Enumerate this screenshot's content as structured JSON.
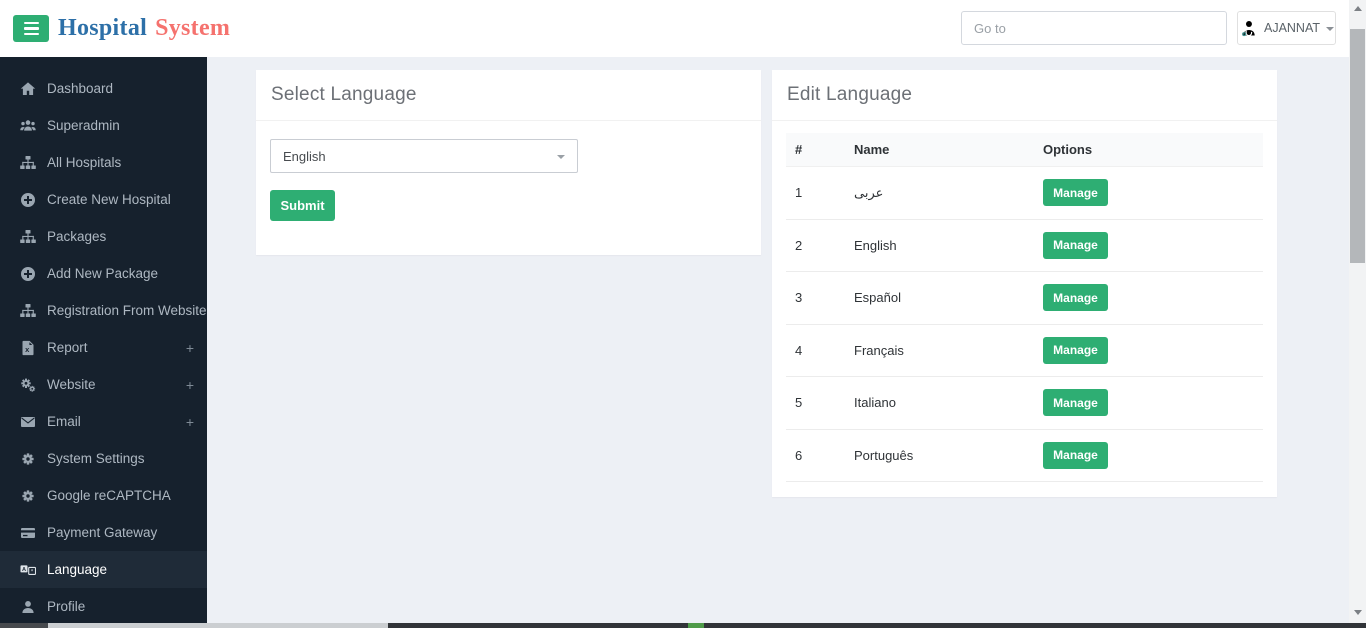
{
  "header": {
    "brand_primary": "Hospital",
    "brand_accent": "System",
    "goto_placeholder": "Go to",
    "user_name": "AJANNAT"
  },
  "sidebar": {
    "expand_glyph": "+",
    "items": [
      {
        "label": "Dashboard",
        "icon": "home"
      },
      {
        "label": "Superadmin",
        "icon": "users"
      },
      {
        "label": "All Hospitals",
        "icon": "sitemap"
      },
      {
        "label": "Create New Hospital",
        "icon": "plus-circle"
      },
      {
        "label": "Packages",
        "icon": "sitemap"
      },
      {
        "label": "Add New Package",
        "icon": "plus-circle"
      },
      {
        "label": "Registration From Website",
        "icon": "sitemap"
      },
      {
        "label": "Report",
        "icon": "file-excel",
        "expandable": true
      },
      {
        "label": "Website",
        "icon": "cogs",
        "expandable": true
      },
      {
        "label": "Email",
        "icon": "email",
        "expandable": true
      },
      {
        "label": "System Settings",
        "icon": "gear"
      },
      {
        "label": "Google reCAPTCHA",
        "icon": "gear"
      },
      {
        "label": "Payment Gateway",
        "icon": "credit-card"
      },
      {
        "label": "Language",
        "icon": "language",
        "active": true
      },
      {
        "label": "Profile",
        "icon": "user"
      }
    ]
  },
  "select_language_panel": {
    "title": "Select Language",
    "selected_language": "English",
    "submit_label": "Submit"
  },
  "edit_language_panel": {
    "title": "Edit Language",
    "columns": [
      "#",
      "Name",
      "Options"
    ],
    "action_label": "Manage",
    "rows": [
      {
        "num": "1",
        "name": "عربى"
      },
      {
        "num": "2",
        "name": "English"
      },
      {
        "num": "3",
        "name": "Español"
      },
      {
        "num": "4",
        "name": "Français"
      },
      {
        "num": "5",
        "name": "Italiano"
      },
      {
        "num": "6",
        "name": "Português"
      }
    ]
  },
  "colors": {
    "accent_green": "#2eae73",
    "sidebar_bg": "#16212d",
    "sidebar_active_bg": "#1f2b38",
    "logo_blue": "#2d70a8",
    "logo_red": "#f5726e",
    "doctor_teal": "#3e8f8d",
    "main_bg": "#edf0f5"
  }
}
